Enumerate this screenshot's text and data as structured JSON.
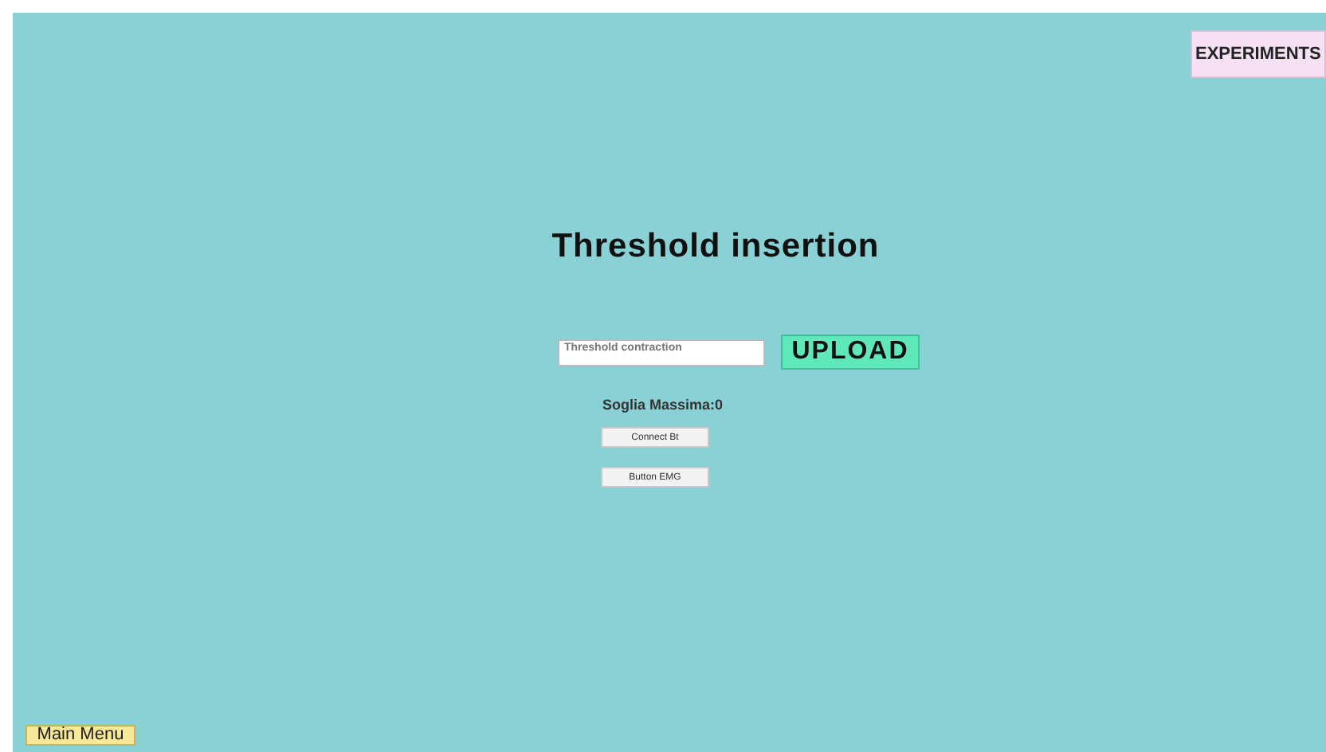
{
  "experiments_button": {
    "label": "EXPERIMENTS"
  },
  "title": "Threshold insertion",
  "threshold_field": {
    "placeholder": "Threshold contraction"
  },
  "upload_button": {
    "label": "UPLOAD"
  },
  "max_threshold": "Soglia Massima:0",
  "buttons": [
    {
      "label": "Connect Bt"
    },
    {
      "label": "Button EMG"
    }
  ],
  "main_menu_button": {
    "label": "Main Menu"
  }
}
